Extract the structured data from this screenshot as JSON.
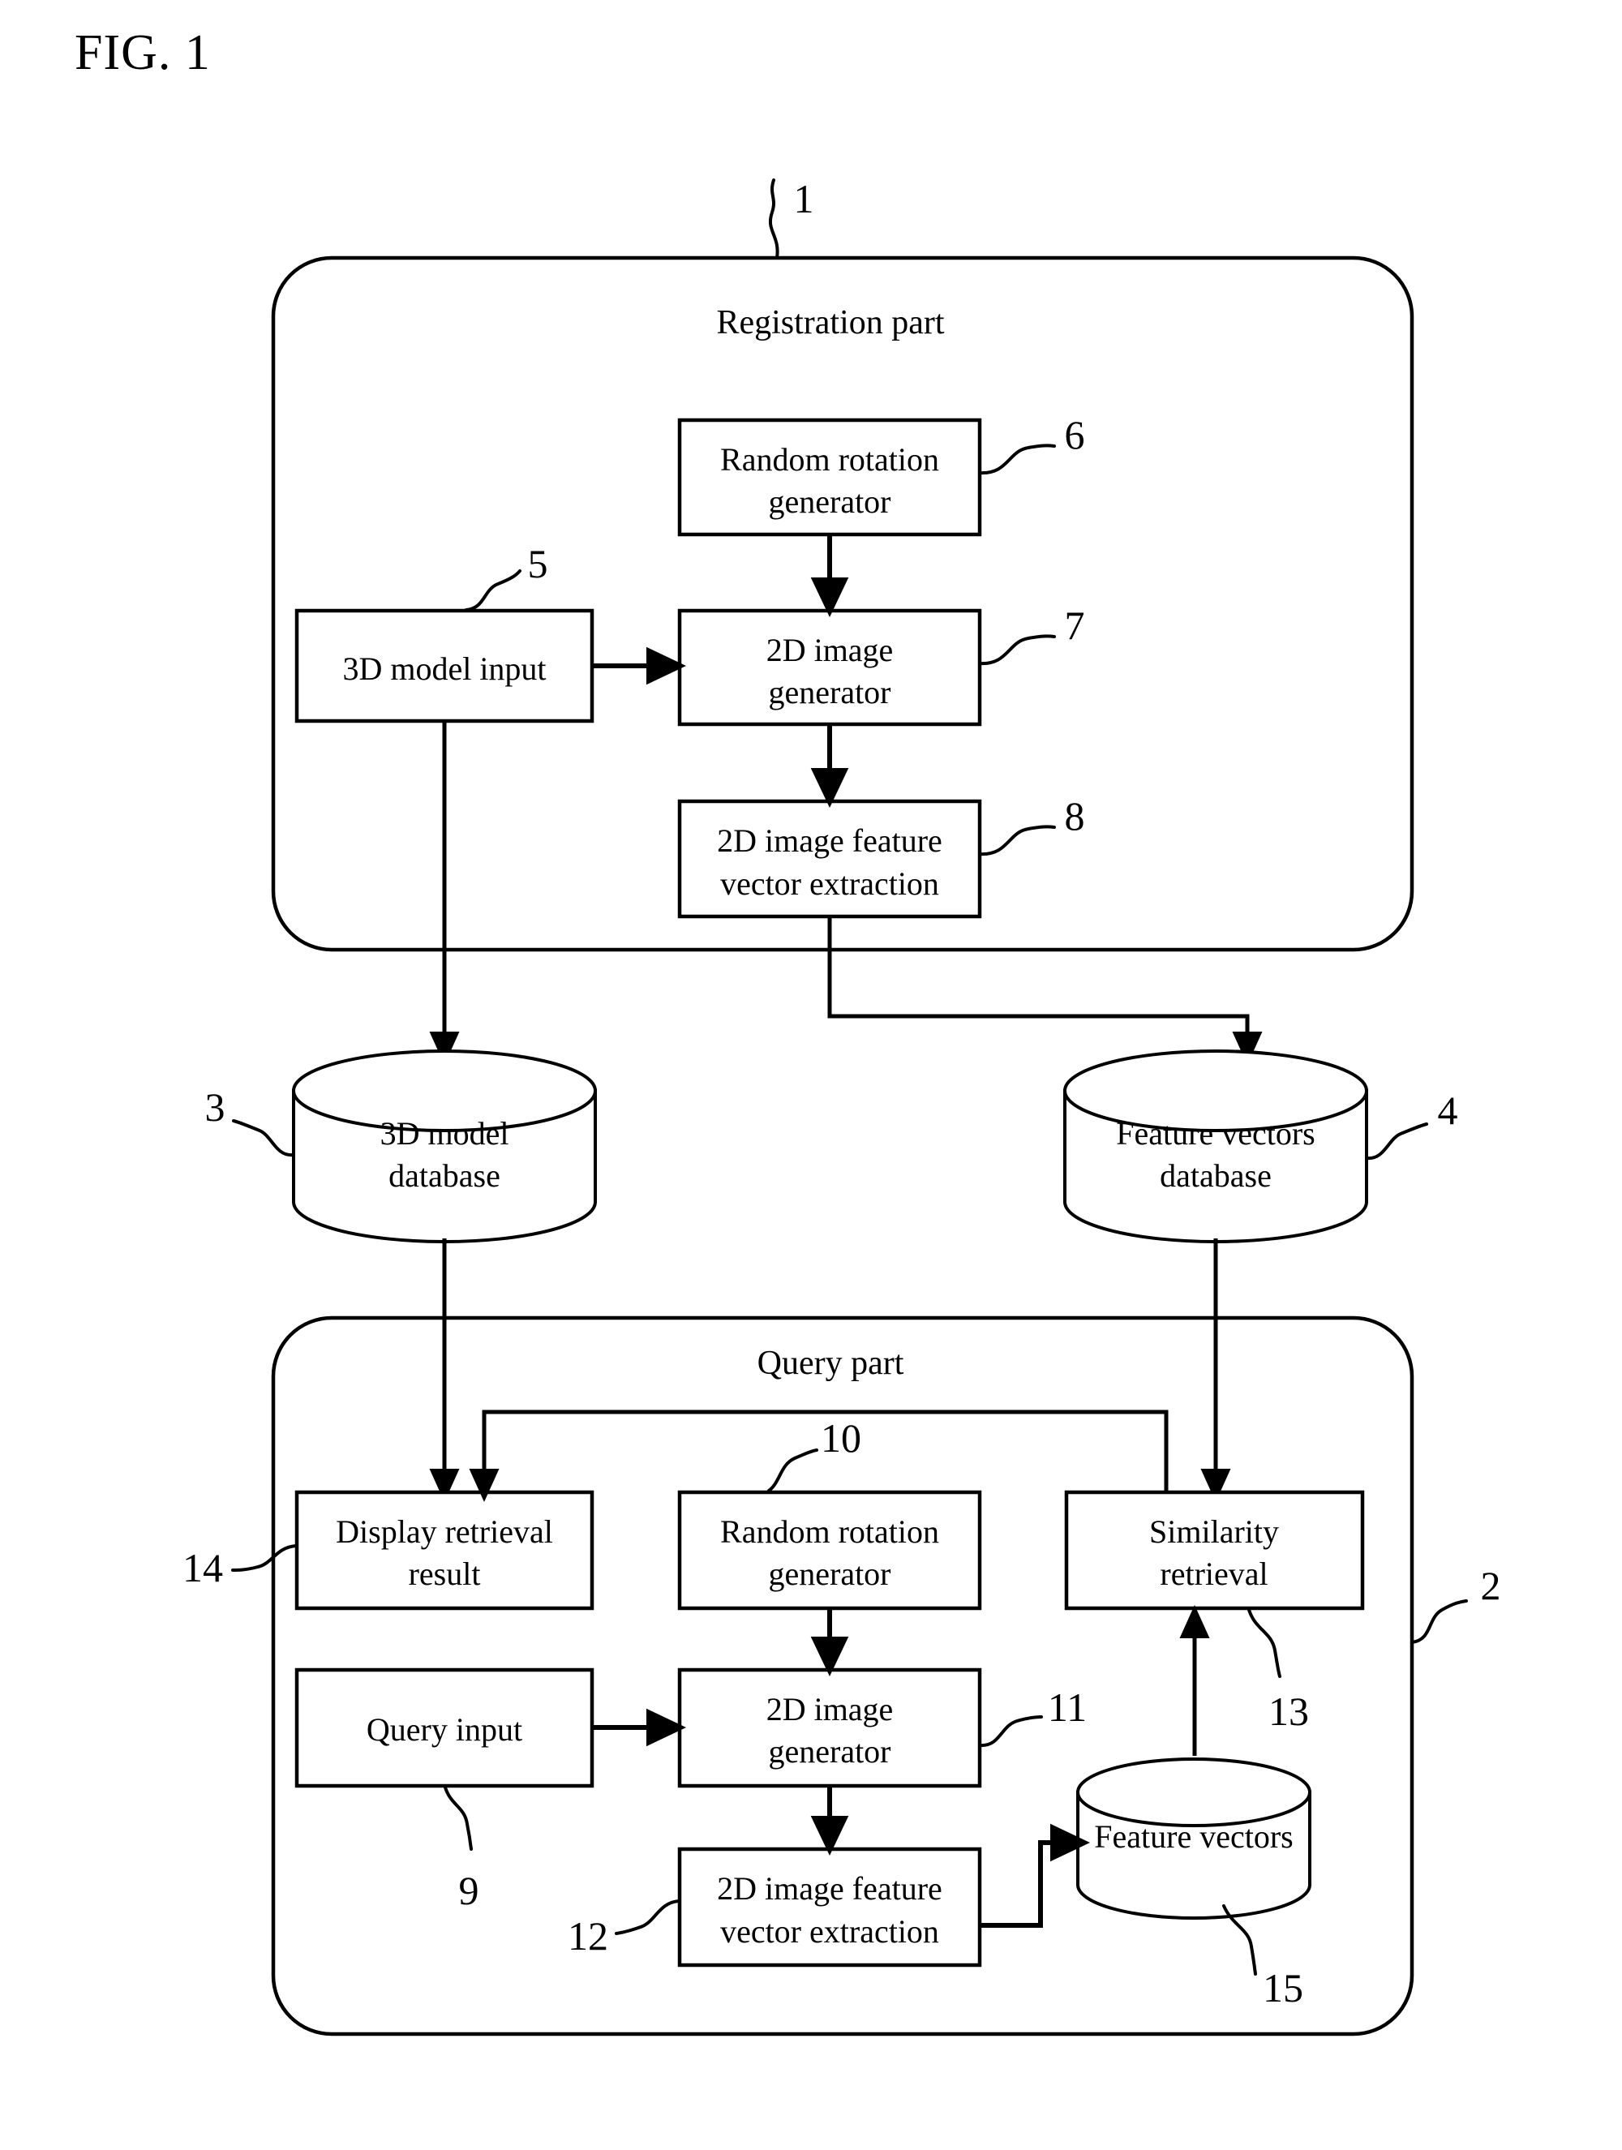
{
  "figure": {
    "title": "FIG. 1",
    "type": "patent-block-diagram"
  },
  "sections": {
    "registration": {
      "label": "Registration part",
      "callout": "1"
    },
    "query": {
      "label": "Query part",
      "callout": "2"
    }
  },
  "registration_blocks": [
    {
      "id": "random-rotation-generator-top",
      "line1": "Random rotation",
      "line2": "generator",
      "callout": "6"
    },
    {
      "id": "model-input",
      "line1": "3D model input",
      "line2": "",
      "callout": "5"
    },
    {
      "id": "image-generator-top",
      "line1": "2D image",
      "line2": "generator",
      "callout": "7"
    },
    {
      "id": "feature-vector-extraction-top",
      "line1": "2D image feature",
      "line2": "vector extraction",
      "callout": "8"
    }
  ],
  "databases": [
    {
      "id": "model-database",
      "line1": "3D model",
      "line2": "database",
      "callout": "3"
    },
    {
      "id": "feature-vectors-database",
      "line1": "Feature vectors",
      "line2": "database",
      "callout": "4"
    },
    {
      "id": "feature-vectors-store",
      "line1": "Feature vectors",
      "line2": "",
      "callout": "15"
    }
  ],
  "query_blocks": [
    {
      "id": "display-retrieval-result",
      "line1": "Display retrieval",
      "line2": "result",
      "callout": "14"
    },
    {
      "id": "random-rotation-generator-bottom",
      "line1": "Random rotation",
      "line2": "generator",
      "callout": "10"
    },
    {
      "id": "similarity-retrieval",
      "line1": "Similarity",
      "line2": "retrieval",
      "callout": "13"
    },
    {
      "id": "query-input",
      "line1": "Query input",
      "line2": "",
      "callout": "9"
    },
    {
      "id": "image-generator-bottom",
      "line1": "2D image",
      "line2": "generator",
      "callout": "11"
    },
    {
      "id": "feature-vector-extraction-bottom",
      "line1": "2D image feature",
      "line2": "vector extraction",
      "callout": "12"
    }
  ],
  "colors": {
    "ink": "#000000",
    "paper": "#ffffff"
  }
}
